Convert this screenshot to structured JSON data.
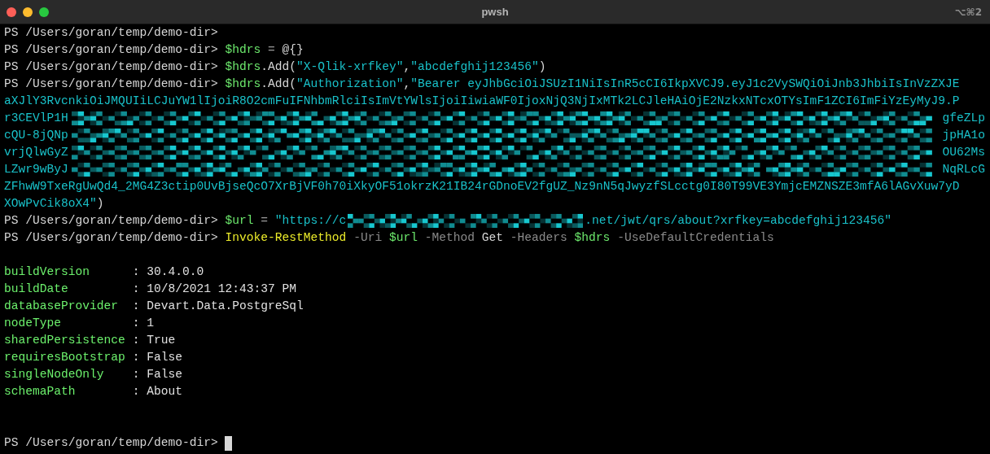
{
  "window": {
    "title": "pwsh",
    "shortcut": "⌥⌘2"
  },
  "lines": [
    {
      "kind": "input",
      "words": [
        [
          {
            "kind": "prompt",
            "text": "PS /Users/goran/temp/demo-dir>"
          }
        ]
      ]
    },
    {
      "kind": "input",
      "words": [
        [
          {
            "kind": "prompt",
            "text": "PS /Users/goran/temp/demo-dir>"
          }
        ],
        [
          {
            "kind": "variable",
            "text": "$hdrs"
          }
        ],
        [
          {
            "kind": "operator",
            "text": "="
          }
        ],
        [
          {
            "kind": "plain",
            "text": "@{}"
          }
        ]
      ]
    },
    {
      "kind": "input",
      "words": [
        [
          {
            "kind": "prompt",
            "text": "PS /Users/goran/temp/demo-dir>"
          }
        ],
        [
          {
            "kind": "variable",
            "text": "$hdrs"
          },
          {
            "kind": "plain",
            "text": ".Add("
          },
          {
            "kind": "string",
            "text": "\"X-Qlik-xrfkey\""
          },
          {
            "kind": "plain",
            "text": ","
          },
          {
            "kind": "string",
            "text": "\"abcdefghij123456\""
          },
          {
            "kind": "plain",
            "text": ")"
          }
        ]
      ]
    },
    {
      "kind": "input",
      "words": [
        [
          {
            "kind": "prompt",
            "text": "PS /Users/goran/temp/demo-dir>"
          }
        ],
        [
          {
            "kind": "variable",
            "text": "$hdrs"
          },
          {
            "kind": "plain",
            "text": ".Add("
          },
          {
            "kind": "string",
            "text": "\"Authorization\""
          },
          {
            "kind": "plain",
            "text": ","
          },
          {
            "kind": "string",
            "text": "\"Bearer"
          }
        ],
        [
          {
            "kind": "string",
            "text": "eyJhbGciOiJSUzI1NiIsInR5cCI6IkpXVCJ9.eyJ1c2VySWQiOiJnb3JhbiIsInVzZXJE"
          }
        ]
      ]
    },
    {
      "kind": "wrap",
      "words": [
        [
          {
            "kind": "string",
            "text": "aXJlY3RvcnkiOiJMQUIiLCJuYW1lIjoiR8O2cmFuIFNhbmRlciIsImVtYWlsIjoiIiwiaWF0IjoxNjQ3NjIxMTk2LCJleHAiOjE2NzkxNTcxOTYsImF1ZCI6ImFiYzEyMyJ9.P"
          }
        ]
      ]
    },
    {
      "kind": "wrap",
      "words": [
        [
          {
            "kind": "string",
            "text": "r3CEVlP1H"
          }
        ],
        [
          {
            "kind": "redacted"
          }
        ],
        [
          {
            "kind": "string",
            "text": "gfeZLp"
          }
        ]
      ]
    },
    {
      "kind": "wrap",
      "words": [
        [
          {
            "kind": "string",
            "text": "cQU-8jQNp"
          }
        ],
        [
          {
            "kind": "redacted"
          }
        ],
        [
          {
            "kind": "string",
            "text": "jpHA1o"
          }
        ]
      ]
    },
    {
      "kind": "wrap",
      "words": [
        [
          {
            "kind": "string",
            "text": "vrjQlwGyZ"
          }
        ],
        [
          {
            "kind": "redacted"
          }
        ],
        [
          {
            "kind": "string",
            "text": "OU62Ms"
          }
        ]
      ]
    },
    {
      "kind": "wrap",
      "words": [
        [
          {
            "kind": "string",
            "text": "LZwr9wByJ"
          }
        ],
        [
          {
            "kind": "redacted"
          }
        ],
        [
          {
            "kind": "string",
            "text": "NqRLcG"
          }
        ]
      ]
    },
    {
      "kind": "wrap",
      "words": [
        [
          {
            "kind": "string",
            "text": "ZFhwW9TxeRgUwQd4_2MG4Z3ctip0UvBjseQcO7XrBjVF0h70iXkyOF51okrzK21IB24rGDnoEV2fgUZ_Nz9nN5qJwyzfSLcctg0I80T99VE3YmjcEMZNSZE3mfA6lAGvXuw7yD"
          }
        ]
      ]
    },
    {
      "kind": "wrap",
      "words": [
        [
          {
            "kind": "string",
            "text": "XOwPvCik8oX4\""
          },
          {
            "kind": "plain",
            "text": ")"
          }
        ]
      ]
    },
    {
      "kind": "input",
      "words": [
        [
          {
            "kind": "prompt",
            "text": "PS /Users/goran/temp/demo-dir>"
          }
        ],
        [
          {
            "kind": "variable",
            "text": "$url"
          }
        ],
        [
          {
            "kind": "operator",
            "text": "="
          }
        ],
        [
          {
            "kind": "string",
            "text": "\"https://c"
          },
          {
            "kind": "redacted-inline"
          },
          {
            "kind": "string",
            "text": ".net/jwt/qrs/about?xrfkey=abcdefghij123456\""
          }
        ]
      ]
    },
    {
      "kind": "input",
      "words": [
        [
          {
            "kind": "prompt",
            "text": "PS /Users/goran/temp/demo-dir>"
          }
        ],
        [
          {
            "kind": "command",
            "text": "Invoke-RestMethod"
          }
        ],
        [
          {
            "kind": "parameter",
            "text": "-Uri"
          }
        ],
        [
          {
            "kind": "variable",
            "text": "$url"
          }
        ],
        [
          {
            "kind": "parameter",
            "text": "-Method"
          }
        ],
        [
          {
            "kind": "plain",
            "text": "Get"
          }
        ],
        [
          {
            "kind": "parameter",
            "text": "-Headers"
          }
        ],
        [
          {
            "kind": "variable",
            "text": "$hdrs"
          }
        ],
        [
          {
            "kind": "parameter",
            "text": "-UseDefaultCredentials"
          }
        ]
      ]
    },
    {
      "kind": "blank"
    },
    {
      "kind": "output",
      "key": "buildVersion",
      "separator": ":",
      "value": "30.4.0.0"
    },
    {
      "kind": "output",
      "key": "buildDate",
      "separator": ":",
      "value": "10/8/2021 12:43:37 PM"
    },
    {
      "kind": "output",
      "key": "databaseProvider",
      "separator": ":",
      "value": "Devart.Data.PostgreSql"
    },
    {
      "kind": "output",
      "key": "nodeType",
      "separator": ":",
      "value": "1"
    },
    {
      "kind": "output",
      "key": "sharedPersistence",
      "separator": ":",
      "value": "True"
    },
    {
      "kind": "output",
      "key": "requiresBootstrap",
      "separator": ":",
      "value": "False"
    },
    {
      "kind": "output",
      "key": "singleNodeOnly",
      "separator": ":",
      "value": "False"
    },
    {
      "kind": "output",
      "key": "schemaPath",
      "separator": ":",
      "value": "About"
    },
    {
      "kind": "blank"
    },
    {
      "kind": "blank"
    },
    {
      "kind": "input",
      "cursor": true,
      "words": [
        [
          {
            "kind": "prompt",
            "text": "PS /Users/goran/temp/demo-dir>"
          }
        ]
      ]
    }
  ]
}
